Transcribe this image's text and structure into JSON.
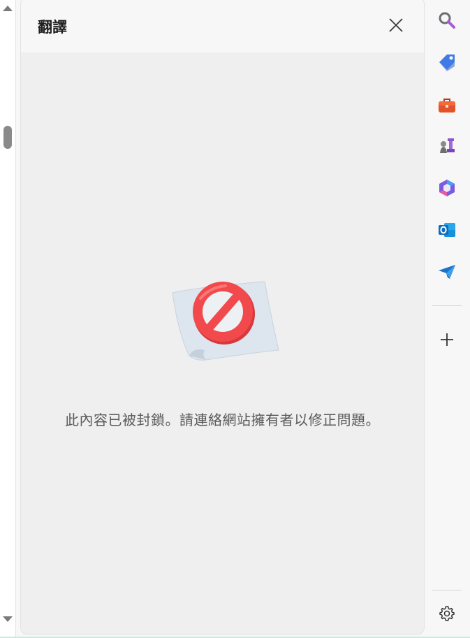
{
  "panel": {
    "title": "翻譯",
    "close_icon": "close-icon",
    "illustration_icon": "blocked-sign-icon",
    "message": "此內容已被封鎖。請連絡網站擁有者以修正問題。"
  },
  "sidebar": {
    "items": [
      {
        "name": "search",
        "icon": "search-icon"
      },
      {
        "name": "shopping",
        "icon": "tag-icon"
      },
      {
        "name": "tools",
        "icon": "toolbox-icon"
      },
      {
        "name": "games",
        "icon": "chess-icon"
      },
      {
        "name": "microsoft-365",
        "icon": "m365-icon"
      },
      {
        "name": "outlook",
        "icon": "outlook-icon"
      },
      {
        "name": "drop",
        "icon": "send-icon"
      }
    ],
    "add_icon": "plus-icon",
    "settings_icon": "gear-icon"
  },
  "colors": {
    "panel_bg": "#efefef",
    "header_bg": "#f7f7f7",
    "block_red": "#f04a4a",
    "accent_blue": "#1a73c8"
  }
}
